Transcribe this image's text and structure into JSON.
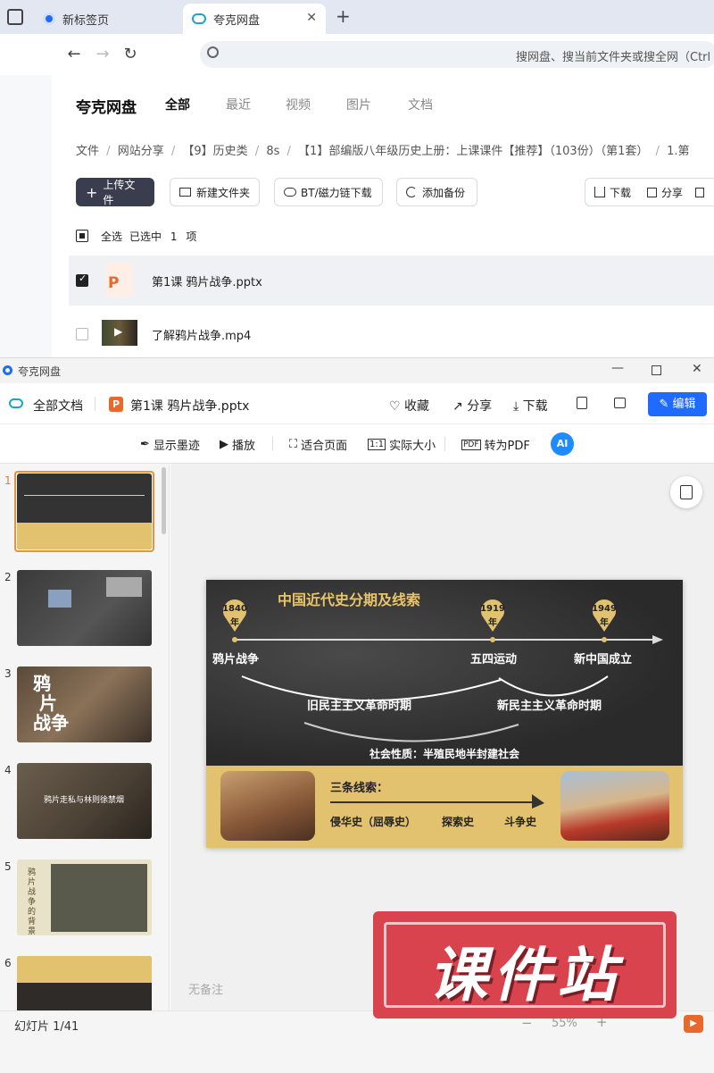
{
  "browser": {
    "tabs": [
      {
        "label": "新标签页"
      },
      {
        "label": "夸克网盘"
      }
    ],
    "new_tab_symbol": "+",
    "address_placeholder": "搜网盘、搜当前文件夹或搜全网（Ctrl +"
  },
  "pan": {
    "brand": "夸克网盘",
    "nav_tabs": [
      "全部",
      "最近",
      "视频",
      "图片",
      "文档"
    ],
    "breadcrumb": [
      "文件",
      "网站分享",
      "【9】历史类",
      "8s",
      "【1】部编版八年级历史上册：上课课件【推荐】（103份）（第1套）",
      "1.第"
    ],
    "breadcrumb_sep": "/",
    "toolbar": {
      "upload": "上传文件",
      "new_folder": "新建文件夹",
      "bt": "BT/磁力链下载",
      "backup": "添加备份",
      "download": "下载",
      "share": "分享"
    },
    "select_all": "全选",
    "selected_text": "已选中",
    "selected_count": "1",
    "selected_unit": "项",
    "files": [
      {
        "name": "第1课 鸦片战争.pptx",
        "checked": true
      },
      {
        "name": "了解鸦片战争.mp4",
        "checked": false
      }
    ]
  },
  "viewer": {
    "window_title": "夸克网盘",
    "all_docs": "全部文档",
    "file_name": "第1课 鸦片战争.pptx",
    "actions": {
      "favorite": "收藏",
      "share": "分享",
      "download": "下载",
      "edit": "编辑"
    },
    "tools": {
      "ink": "显示墨迹",
      "play": "播放",
      "fit": "适合页面",
      "actual": "实际大小",
      "pdf": "转为PDF",
      "ai": "AI"
    },
    "thumb_numbers": [
      "1",
      "2",
      "3",
      "4",
      "5",
      "6"
    ],
    "notes_placeholder": "无备注",
    "status": "幻灯片 1/41",
    "zoom": "55%"
  },
  "slide": {
    "title": "中国近代史分期及线索",
    "years": [
      "1840\n年",
      "1919\n年",
      "1949\n年"
    ],
    "year1": "1840",
    "year2": "1919",
    "year3": "1949",
    "year_suffix": "年",
    "events": [
      "鸦片战争",
      "五四运动",
      "新中国成立"
    ],
    "periods": [
      "旧民主主义革命时期",
      "新民主主义革命时期"
    ],
    "nature": "社会性质：半殖民地半封建社会",
    "threads_title": "三条线索：",
    "threads": [
      "侵华史（屈辱史）",
      "探索史",
      "斗争史"
    ]
  },
  "watermark": {
    "text": "课件站"
  },
  "colors": {
    "accent": "#1f6bff",
    "upload_btn": "#3a3d4d",
    "gold": "#e2c16f",
    "ppt_orange": "#e8692b",
    "watermark_red": "#d9434e"
  }
}
